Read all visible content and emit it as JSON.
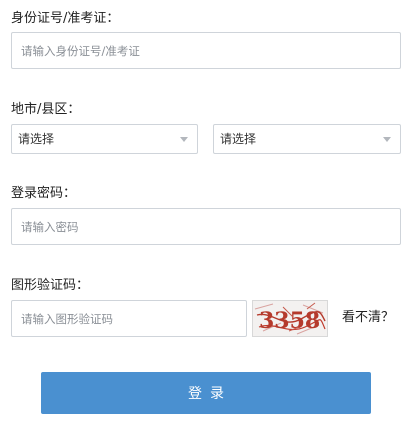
{
  "form": {
    "id_number": {
      "label": "身份证号/准考证：",
      "placeholder": "请输入身份证号/准考证"
    },
    "region": {
      "label": "地市/县区：",
      "city_select": {
        "value": "请选择"
      },
      "county_select": {
        "value": "请选择"
      }
    },
    "password": {
      "label": "登录密码：",
      "placeholder": "请输入密码"
    },
    "captcha": {
      "label": "图形验证码：",
      "placeholder": "请输入图形验证码",
      "image_text": "3358",
      "refresh_label": "看不清？"
    },
    "submit": {
      "label": "登录"
    }
  },
  "colors": {
    "button_bg": "#4a90d0",
    "button_text": "#ffffff",
    "border": "#cfd4da",
    "captcha_text": "#c0392b",
    "placeholder": "#8a8f96"
  },
  "icons": {
    "select_caret": "chevron-down-icon"
  }
}
